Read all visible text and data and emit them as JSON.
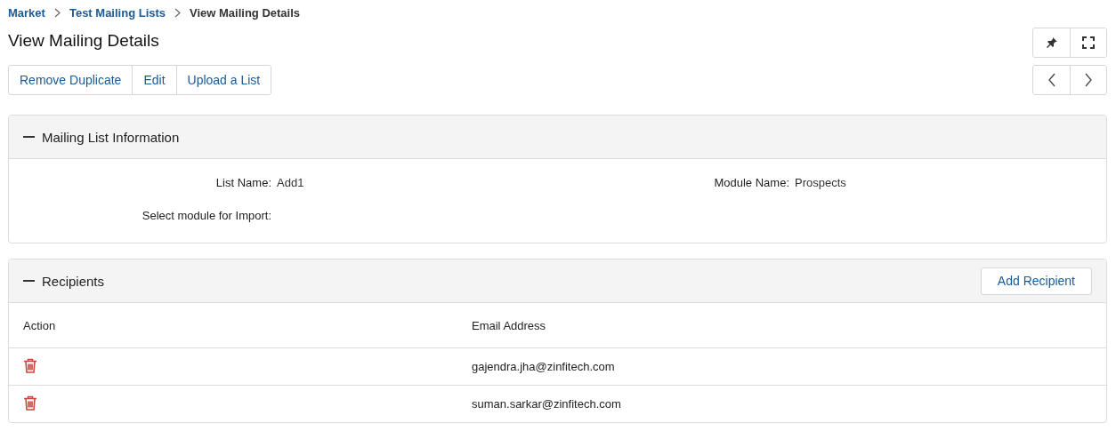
{
  "breadcrumb": [
    {
      "label": "Market",
      "kind": "link"
    },
    {
      "label": "Test Mailing Lists",
      "kind": "link"
    },
    {
      "label": "View Mailing Details",
      "kind": "current"
    }
  ],
  "title": "View Mailing Details",
  "actions": [
    "Remove Duplicate",
    "Edit",
    "Upload a List"
  ],
  "info_panel": {
    "title": "Mailing List Information",
    "expanded": true,
    "fields": [
      {
        "label": "List Name:",
        "value": "Add1"
      },
      {
        "label": "Module Name:",
        "value": "Prospects"
      },
      {
        "label": "Select module for Import:"
      }
    ]
  },
  "recipients_panel": {
    "title": "Recipients",
    "expanded": true,
    "button": "Add Recipient",
    "columns": [
      "Action",
      "Email Address"
    ],
    "rows": [
      {
        "email": "gajendra.jha@zinfitech.com"
      },
      {
        "email": "suman.sarkar@zinfitech.com"
      }
    ]
  }
}
